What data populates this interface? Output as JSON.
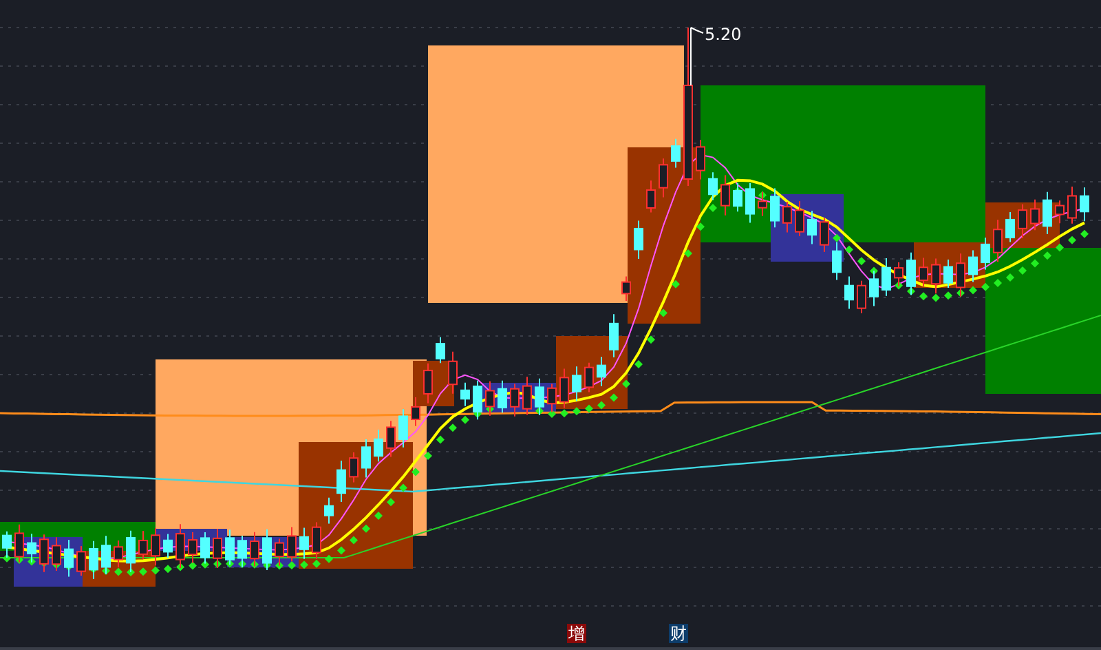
{
  "chart": {
    "peak_label": "5.20"
  },
  "markers": [
    {
      "label": "增",
      "color": "#8b0a0a"
    },
    {
      "label": "财",
      "color": "#0d3d6b"
    }
  ]
}
